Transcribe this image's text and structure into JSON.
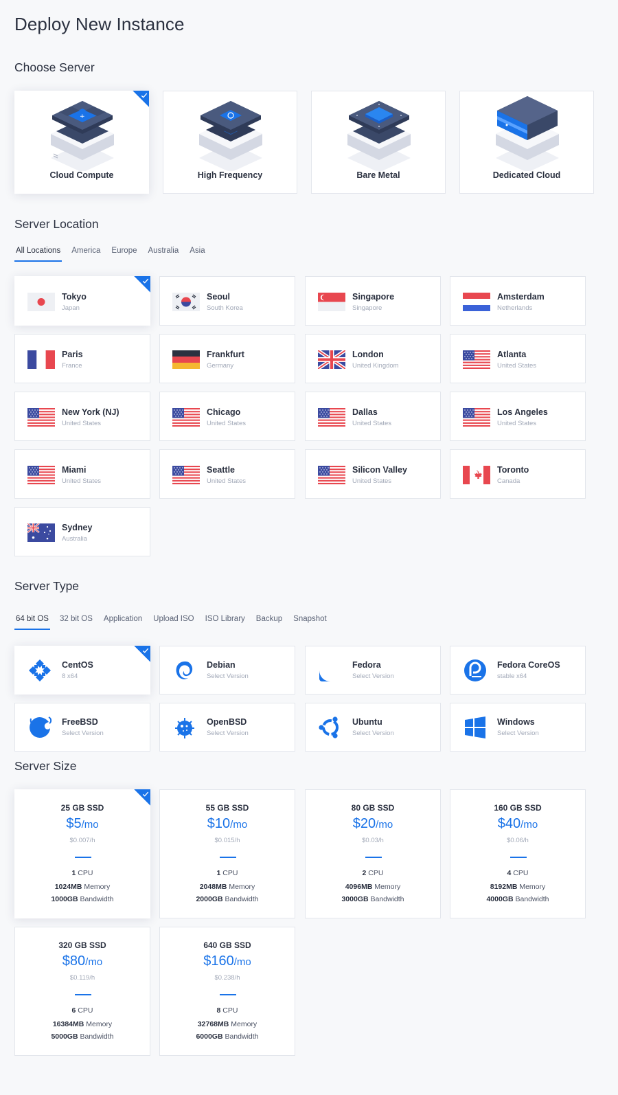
{
  "page": {
    "title": "Deploy New Instance"
  },
  "sections": {
    "server": "Choose Server",
    "location": "Server Location",
    "type": "Server Type",
    "size": "Server Size"
  },
  "colors": {
    "accent": "#1a73e8",
    "dark_tile": "#3a4868",
    "light_tile": "#e6e8ef"
  },
  "servers": [
    {
      "label": "Cloud Compute",
      "selected": true
    },
    {
      "label": "High Frequency",
      "selected": false
    },
    {
      "label": "Bare Metal",
      "selected": false
    },
    {
      "label": "Dedicated Cloud",
      "selected": false
    }
  ],
  "location_tabs": [
    {
      "label": "All Locations",
      "active": true
    },
    {
      "label": "America",
      "active": false
    },
    {
      "label": "Europe",
      "active": false
    },
    {
      "label": "Australia",
      "active": false
    },
    {
      "label": "Asia",
      "active": false
    }
  ],
  "locations": [
    {
      "city": "Tokyo",
      "country": "Japan",
      "flag": "jp-flag-icon",
      "selected": true
    },
    {
      "city": "Seoul",
      "country": "South Korea",
      "flag": "kr-flag-icon"
    },
    {
      "city": "Singapore",
      "country": "Singapore",
      "flag": "sg-flag-icon"
    },
    {
      "city": "Amsterdam",
      "country": "Netherlands",
      "flag": "nl-flag-icon"
    },
    {
      "city": "Paris",
      "country": "France",
      "flag": "fr-flag-icon"
    },
    {
      "city": "Frankfurt",
      "country": "Germany",
      "flag": "de-flag-icon"
    },
    {
      "city": "London",
      "country": "United Kingdom",
      "flag": "uk-flag-icon"
    },
    {
      "city": "Atlanta",
      "country": "United States",
      "flag": "us-flag-icon"
    },
    {
      "city": "New York (NJ)",
      "country": "United States",
      "flag": "us-flag-icon"
    },
    {
      "city": "Chicago",
      "country": "United States",
      "flag": "us-flag-icon"
    },
    {
      "city": "Dallas",
      "country": "United States",
      "flag": "us-flag-icon"
    },
    {
      "city": "Los Angeles",
      "country": "United States",
      "flag": "us-flag-icon"
    },
    {
      "city": "Miami",
      "country": "United States",
      "flag": "us-flag-icon"
    },
    {
      "city": "Seattle",
      "country": "United States",
      "flag": "us-flag-icon"
    },
    {
      "city": "Silicon Valley",
      "country": "United States",
      "flag": "us-flag-icon"
    },
    {
      "city": "Toronto",
      "country": "Canada",
      "flag": "ca-flag-icon"
    },
    {
      "city": "Sydney",
      "country": "Australia",
      "flag": "au-flag-icon"
    }
  ],
  "type_tabs": [
    {
      "label": "64 bit OS",
      "active": true
    },
    {
      "label": "32 bit OS",
      "active": false
    },
    {
      "label": "Application",
      "active": false
    },
    {
      "label": "Upload ISO",
      "active": false
    },
    {
      "label": "ISO Library",
      "active": false
    },
    {
      "label": "Backup",
      "active": false
    },
    {
      "label": "Snapshot",
      "active": false
    }
  ],
  "os": [
    {
      "name": "CentOS",
      "version": "8  x64",
      "icon": "centos-icon",
      "selected": true
    },
    {
      "name": "Debian",
      "version": "Select Version",
      "icon": "debian-icon"
    },
    {
      "name": "Fedora",
      "version": "Select Version",
      "icon": "fedora-icon"
    },
    {
      "name": "Fedora CoreOS",
      "version": "stable  x64",
      "icon": "fedora-coreos-icon"
    },
    {
      "name": "FreeBSD",
      "version": "Select Version",
      "icon": "freebsd-icon"
    },
    {
      "name": "OpenBSD",
      "version": "Select Version",
      "icon": "openbsd-icon"
    },
    {
      "name": "Ubuntu",
      "version": "Select Version",
      "icon": "ubuntu-icon"
    },
    {
      "name": "Windows",
      "version": "Select Version",
      "icon": "windows-icon"
    }
  ],
  "sizes": [
    {
      "ssd": "25 GB SSD",
      "price": "$5",
      "per": "/mo",
      "hourly": "$0.007/h",
      "cpu": "1",
      "cpu_label": "CPU",
      "memory": "1024MB",
      "memory_label": "Memory",
      "bandwidth": "1000GB",
      "bandwidth_label": "Bandwidth",
      "selected": true
    },
    {
      "ssd": "55 GB SSD",
      "price": "$10",
      "per": "/mo",
      "hourly": "$0.015/h",
      "cpu": "1",
      "cpu_label": "CPU",
      "memory": "2048MB",
      "memory_label": "Memory",
      "bandwidth": "2000GB",
      "bandwidth_label": "Bandwidth"
    },
    {
      "ssd": "80 GB SSD",
      "price": "$20",
      "per": "/mo",
      "hourly": "$0.03/h",
      "cpu": "2",
      "cpu_label": "CPU",
      "memory": "4096MB",
      "memory_label": "Memory",
      "bandwidth": "3000GB",
      "bandwidth_label": "Bandwidth"
    },
    {
      "ssd": "160 GB SSD",
      "price": "$40",
      "per": "/mo",
      "hourly": "$0.06/h",
      "cpu": "4",
      "cpu_label": "CPU",
      "memory": "8192MB",
      "memory_label": "Memory",
      "bandwidth": "4000GB",
      "bandwidth_label": "Bandwidth"
    },
    {
      "ssd": "320 GB SSD",
      "price": "$80",
      "per": "/mo",
      "hourly": "$0.119/h",
      "cpu": "6",
      "cpu_label": "CPU",
      "memory": "16384MB",
      "memory_label": "Memory",
      "bandwidth": "5000GB",
      "bandwidth_label": "Bandwidth"
    },
    {
      "ssd": "640 GB SSD",
      "price": "$160",
      "per": "/mo",
      "hourly": "$0.238/h",
      "cpu": "8",
      "cpu_label": "CPU",
      "memory": "32768MB",
      "memory_label": "Memory",
      "bandwidth": "6000GB",
      "bandwidth_label": "Bandwidth"
    }
  ]
}
